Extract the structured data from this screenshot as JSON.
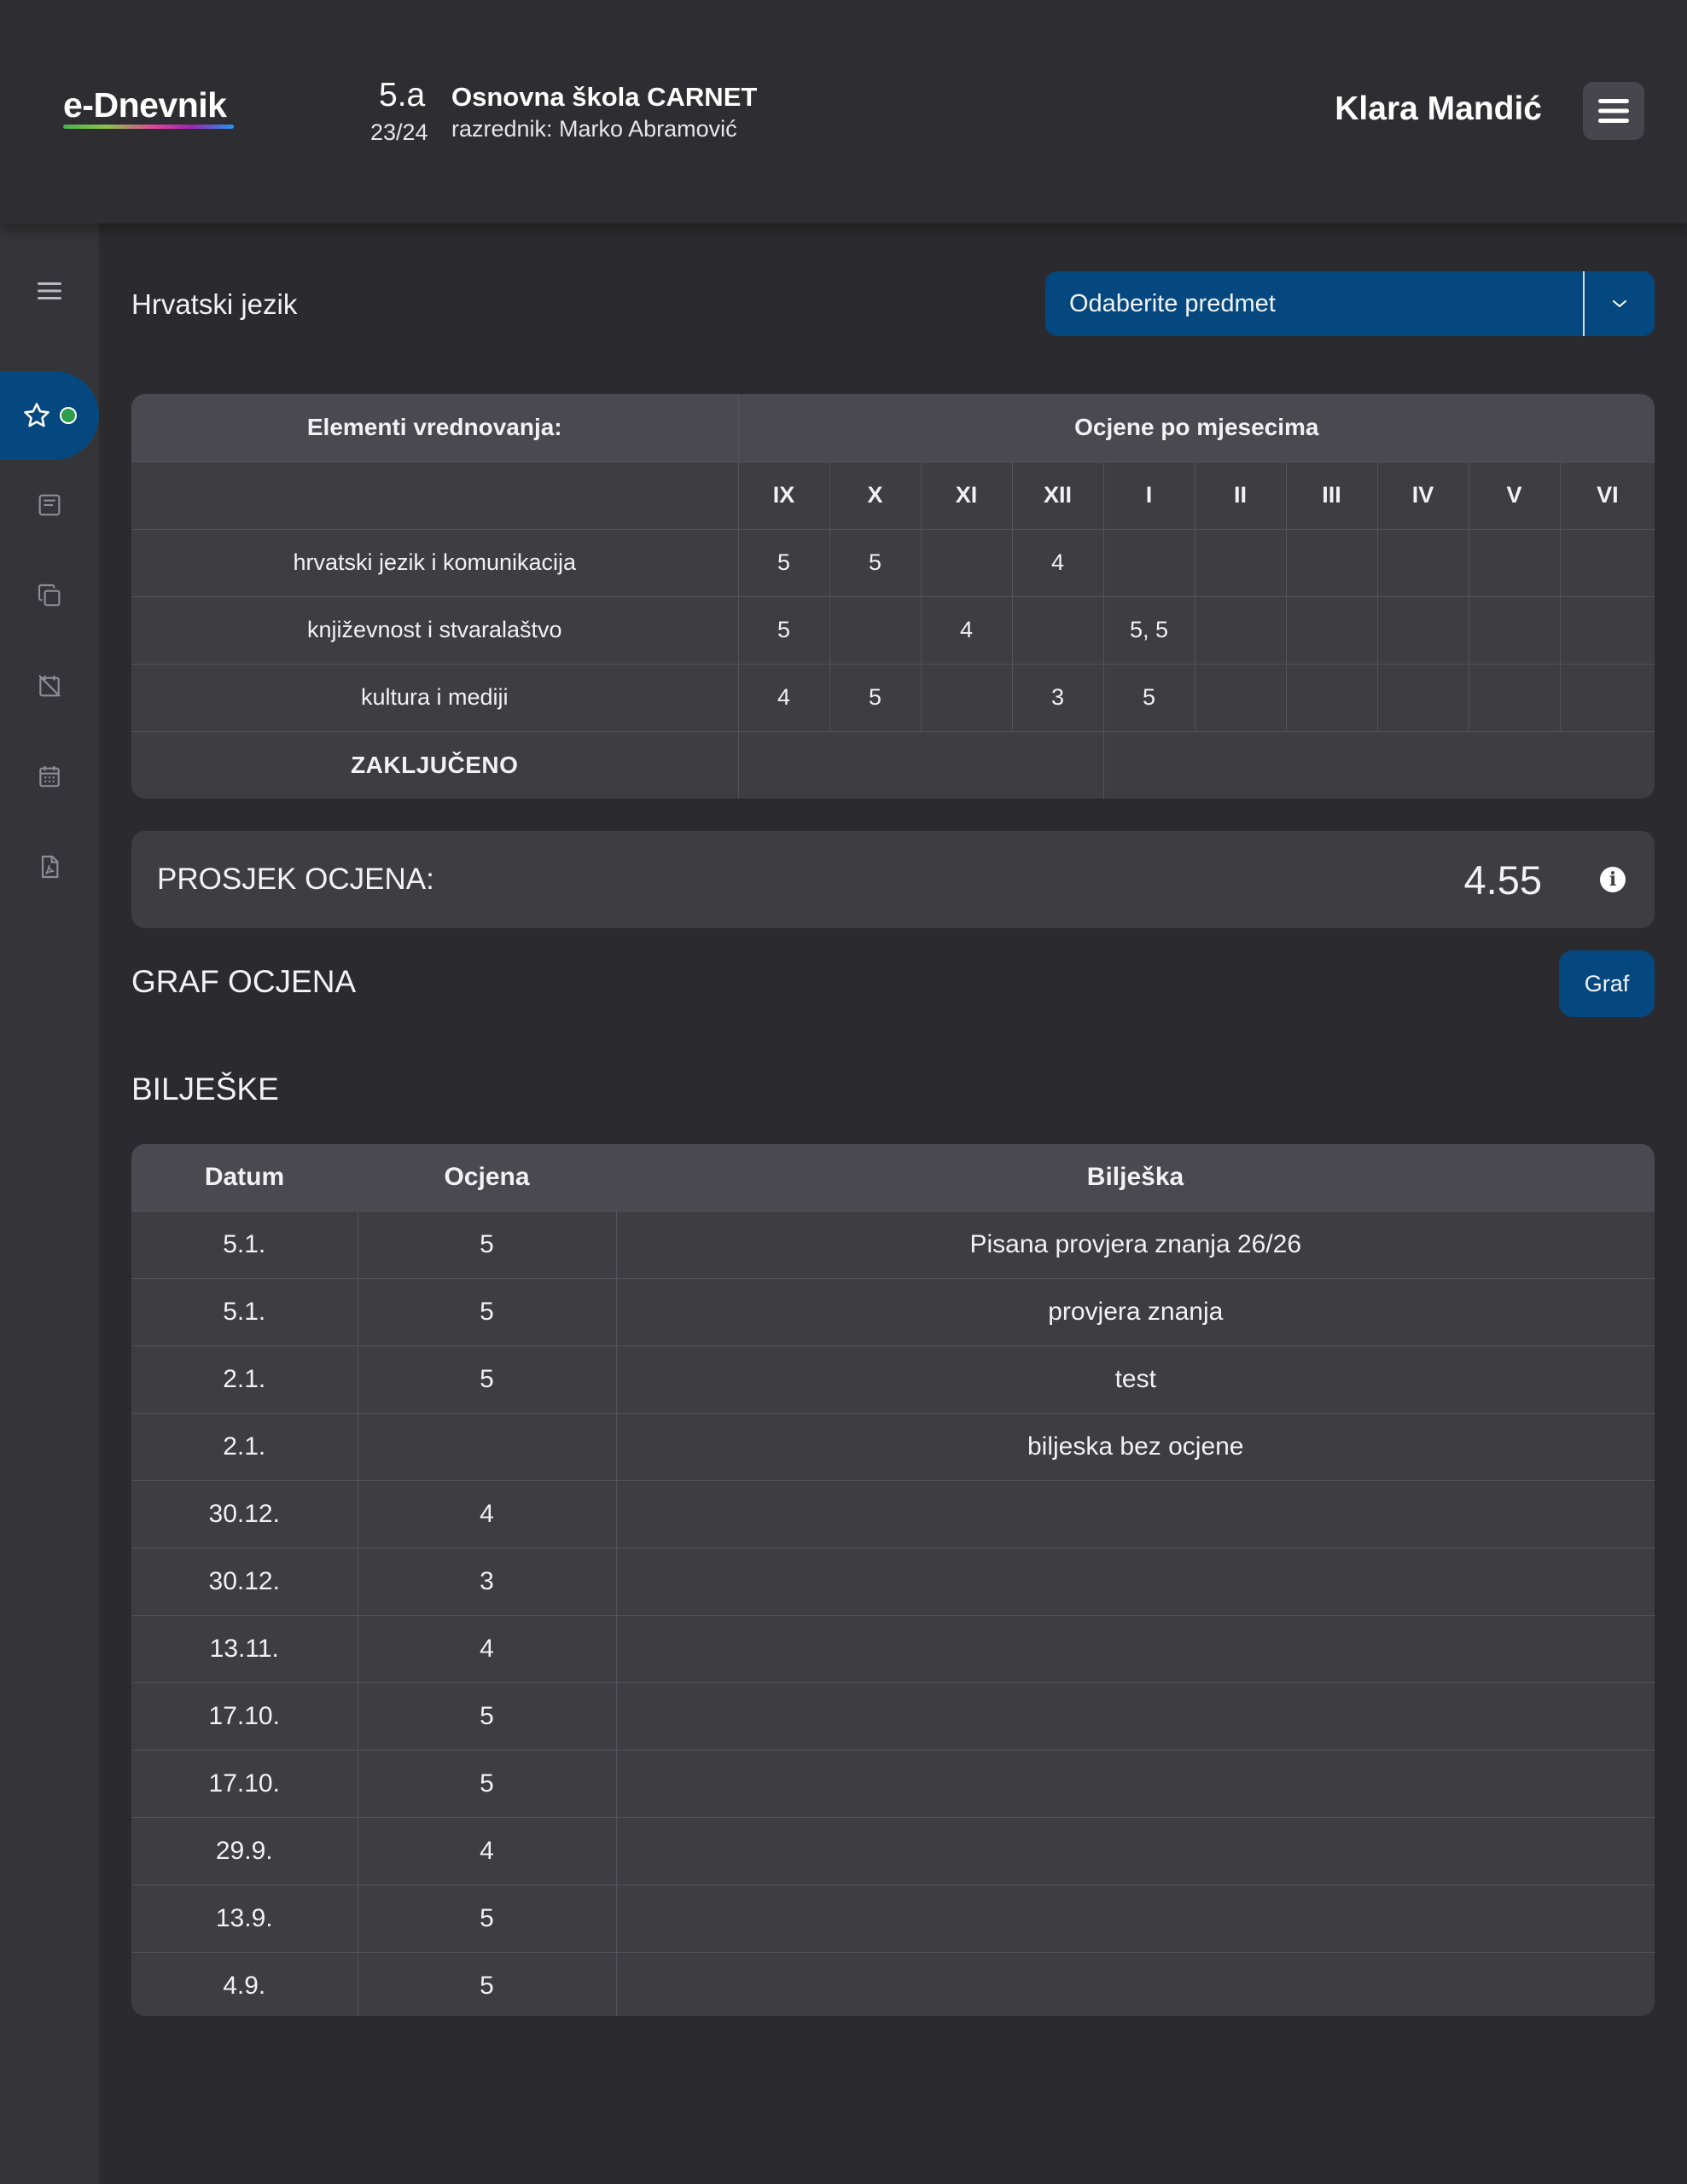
{
  "header": {
    "logo": "e-Dnevnik",
    "class_name": "5.a",
    "class_year": "23/24",
    "school_name": "Osnovna škola CARNET",
    "teacher": "razrednik: Marko Abramović",
    "user_name": "Klara Mandić"
  },
  "sidebar": {
    "items": [
      {
        "icon": "menu-icon"
      },
      {
        "icon": "star-icon",
        "active": true
      },
      {
        "icon": "notes-icon"
      },
      {
        "icon": "copy-icon"
      },
      {
        "icon": "calendar-off-icon"
      },
      {
        "icon": "calendar-icon"
      },
      {
        "icon": "pdf-icon"
      }
    ]
  },
  "subject": {
    "title": "Hrvatski jezik",
    "select_label": "Odaberite predmet"
  },
  "grades_table": {
    "header_left": "Elementi vrednovanja:",
    "header_right": "Ocjene po mjesecima",
    "months": [
      "IX",
      "X",
      "XI",
      "XII",
      "I",
      "II",
      "III",
      "IV",
      "V",
      "VI"
    ],
    "rows": [
      {
        "label": "hrvatski jezik i komunikacija",
        "cells": [
          "5",
          "5",
          "",
          "4",
          "",
          "",
          "",
          "",
          "",
          ""
        ]
      },
      {
        "label": "književnost i stvaralaštvo",
        "cells": [
          "5",
          "",
          "4",
          "",
          "5, 5",
          "",
          "",
          "",
          "",
          ""
        ]
      },
      {
        "label": "kultura i mediji",
        "cells": [
          "4",
          "5",
          "",
          "3",
          "5",
          "",
          "",
          "",
          "",
          ""
        ]
      }
    ],
    "final_label": "ZAKLJUČENO"
  },
  "average": {
    "label": "PROSJEK OCJENA:",
    "value": "4.55",
    "info_glyph": "i"
  },
  "graph": {
    "title": "GRAF OCJENA",
    "button_label": "Graf"
  },
  "notes": {
    "title": "BILJEŠKE",
    "columns": [
      "Datum",
      "Ocjena",
      "Bilješka"
    ],
    "rows": [
      {
        "date": "5.1.",
        "grade": "5",
        "note": "Pisana provjera znanja 26/26"
      },
      {
        "date": "5.1.",
        "grade": "5",
        "note": "provjera znanja"
      },
      {
        "date": "2.1.",
        "grade": "5",
        "note": "test"
      },
      {
        "date": "2.1.",
        "grade": "",
        "note": "biljeska bez ocjene"
      },
      {
        "date": "30.12.",
        "grade": "4",
        "note": ""
      },
      {
        "date": "30.12.",
        "grade": "3",
        "note": ""
      },
      {
        "date": "13.11.",
        "grade": "4",
        "note": ""
      },
      {
        "date": "17.10.",
        "grade": "5",
        "note": ""
      },
      {
        "date": "17.10.",
        "grade": "5",
        "note": ""
      },
      {
        "date": "29.9.",
        "grade": "4",
        "note": ""
      },
      {
        "date": "13.9.",
        "grade": "5",
        "note": ""
      },
      {
        "date": "4.9.",
        "grade": "5",
        "note": ""
      }
    ]
  },
  "colors": {
    "background": "#2b2b2f",
    "accent": "#05487f",
    "status_dot": "#2e9e4a"
  }
}
